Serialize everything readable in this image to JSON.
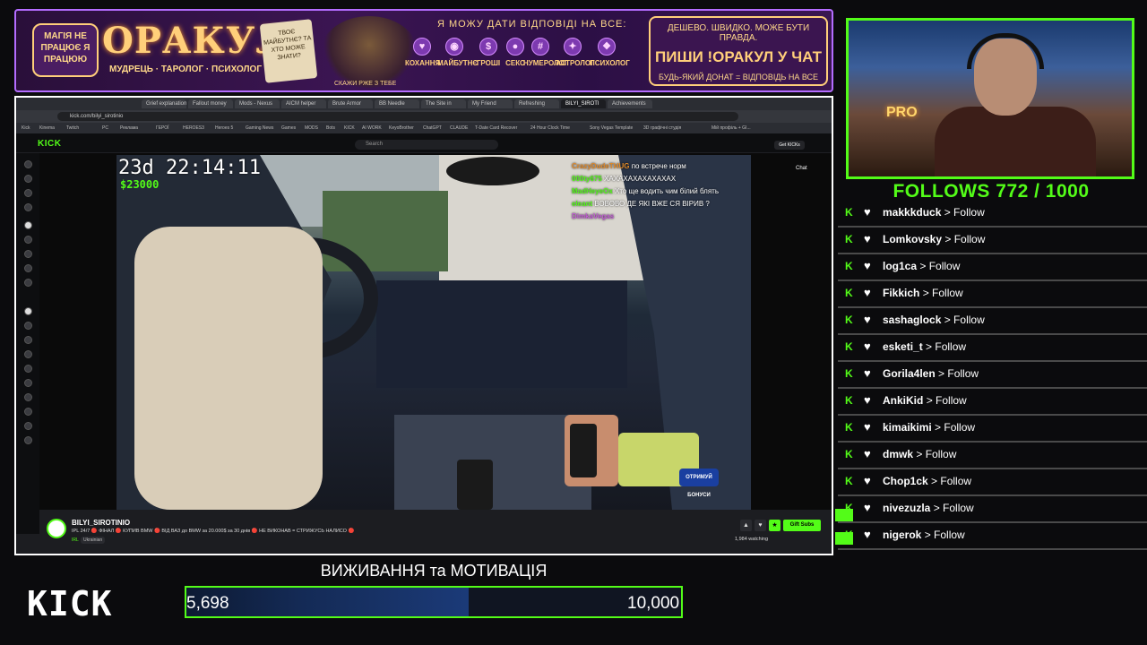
{
  "banner": {
    "left_pill": "МАГІЯ НЕ ПРАЦЮЄ Я ПРАЦЮЮ",
    "brand": "ОРАКУЛ",
    "brand_sub": "МУДРЕЦЬ · ТАРОЛОГ · ПСИХОЛОГ",
    "card_text": "ТВОЄ МАЙБУТНЄ? ТА ХТО МОЖЕ ЗНАТИ?",
    "wizard_caption": "СКАЖИ РЖЕ З ТЕБЕ",
    "ask_line": "Я МОЖУ ДАТИ ВІДПОВІДІ НА ВСЕ:",
    "topics": [
      "КОХАННЯ",
      "МАЙБУТНЄ",
      "ГРОШІ",
      "СЕКС",
      "НУМЕРОЛОГ",
      "АСТРОЛОГ",
      "ПСИХОЛОГ"
    ],
    "cta_line1": "ДЕШЕВО. ШВИДКО. МОЖЕ БУТИ ПРАВДА.",
    "cta_line2": "ПИШИ !ОРАКУЛ У ЧАТ",
    "cta_line3": "БУДЬ-ЯКИЙ ДОНАТ = ВІДПОВІДЬ НА ВСЕ"
  },
  "browser": {
    "tabs": [
      "Grief explanation",
      "Fallout money",
      "Mods - Nexus",
      "AICM helper",
      "Brute Armor",
      "BB Needle",
      "The Site in",
      "My Friend",
      "Refreshing",
      "BILYI_SIROTI",
      "Achievements"
    ],
    "url": "kick.com/bilyi_sirotinio",
    "bookmarks": [
      "Kick",
      "Kinema",
      "Twitch",
      "PC",
      "Реклама",
      "ГЕРОЇ",
      "HEROES3",
      "Heroes 5",
      "Gaming News",
      "Games",
      "MODS",
      "Bots",
      "KICK",
      "AI WORK",
      "KeyoBrother",
      "ChatGPT",
      "CLAUDE",
      "T-Date Card Recover",
      "24 Hour Clock Time",
      "Sony Vegas Template",
      "3D графічні студія",
      "Мій профіль + GI..."
    ]
  },
  "kick": {
    "logo": "KICK",
    "search_placeholder": "Search",
    "get_kicks": "Get KICKs",
    "chat_label": "Chat"
  },
  "video": {
    "timestamp": "23d 22:14:11",
    "money": "$23000",
    "chat": [
      {
        "user": "CrazyDudeTHUG",
        "msg": "по встрече норм",
        "color": "#e08a2a"
      },
      {
        "user": "000ty675",
        "msg": "ХАХАХАХАХАХАХАХ",
        "color": "#53fc18"
      },
      {
        "user": "MadHeyeOx",
        "msg": "Хто ще водить чим білий блять",
        "color": "#53fc18"
      },
      {
        "user": "eleant",
        "msg": "ВОВОВО ДЕ ЯКІ ВЖЕ СЯ ВІРИВ ?",
        "color": "#53fc18"
      },
      {
        "user": "DimkaVegas",
        "msg": "",
        "color": "#c45ad8"
      }
    ],
    "bonus_label": "ОТРИМУЙ БОНУСИ"
  },
  "stream": {
    "channel": "BILYI_SIROTINIO",
    "title": "IPL 24/7 🔴 ФІНАЛ 🔴 КУПИВ BMW 🔴 ВІД ВАЗ до BMW за 20.000$ за 30 днів 🔴 НЕ ВИКОНАВ = СТРИЖУСЬ НАЛИСО 🔴",
    "tag1": "IRL",
    "tag2": "Ukrainian",
    "gift_subs": "Gift Subs",
    "watching": "1,984 watching"
  },
  "follows": {
    "title": "FOLLOWS 772 / 1000",
    "action": "> Follow",
    "items": [
      "makkkduck",
      "Lomkovsky",
      "log1ca",
      "Fikkich",
      "sashaglock",
      "esketi_t",
      "Gorila4len",
      "AnkiKid",
      "kimaikimi",
      "dmwk",
      "Chop1ck",
      "nivezuzla",
      "nigerok"
    ]
  },
  "bottom": {
    "kick_logo": "KICK",
    "goal_title": "ВИЖИВАННЯ та МОТИВАЦІЯ",
    "goal_current": "5,698",
    "goal_target": "10,000",
    "goal_progress": 0.5698
  },
  "colors": {
    "kick_green": "#53fc18",
    "banner_purple": "#b46cff",
    "gold": "#ffcf7a"
  }
}
